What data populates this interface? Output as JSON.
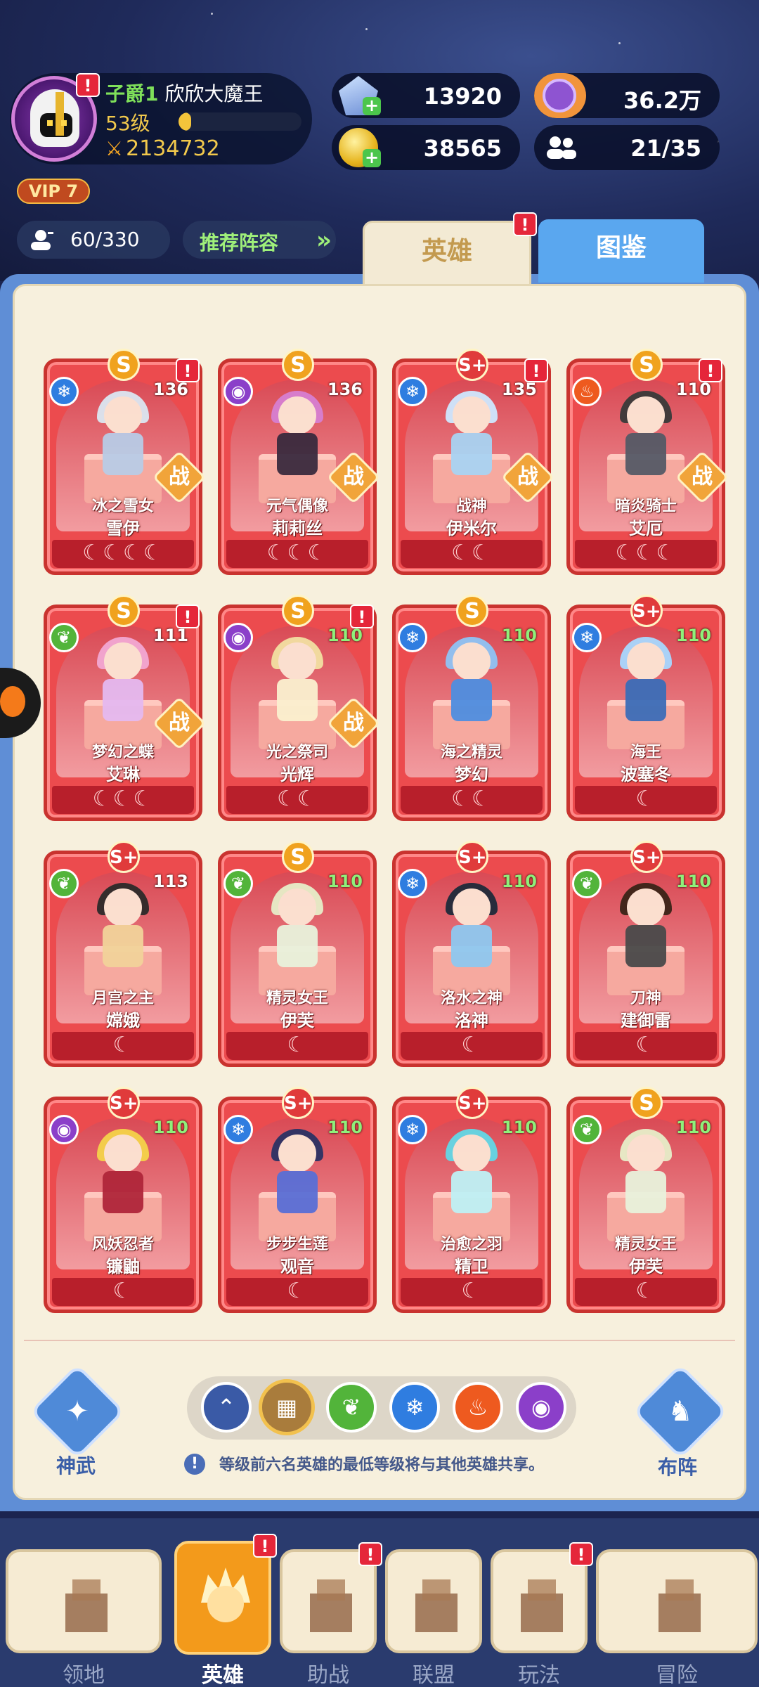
{
  "player": {
    "rank": "子爵1",
    "name": "欣欣大魔王",
    "level": "53级",
    "level_progress": 0.1,
    "power": "2134732",
    "vip": "VIP 7"
  },
  "currencies": {
    "diamonds": "13920",
    "energy": "36.2万",
    "energy_fill_pct": 28,
    "gold": "38565",
    "members": "21/35"
  },
  "hero_count": "60/330",
  "recommend_label": "推荐阵容",
  "tabs": [
    {
      "label": "英雄",
      "active": true,
      "alert": "!"
    },
    {
      "label": "图鉴",
      "active": false
    }
  ],
  "heroes": [
    {
      "grade": "S",
      "element": "ice",
      "level": "136",
      "title": "冰之雪女",
      "name": "雪伊",
      "moons": "☾☾☾☾",
      "battle": "战",
      "alert": "!",
      "hair": "#dbe7f2",
      "outfit": "#b8cbe6"
    },
    {
      "grade": "S",
      "element": "dark",
      "level": "136",
      "title": "元气偶像",
      "name": "莉莉丝",
      "moons": "☾☾☾",
      "battle": "战",
      "alert": "",
      "hair": "#d77fd1",
      "outfit": "#3a2a3e"
    },
    {
      "grade": "S+",
      "element": "ice",
      "level": "135",
      "title": "战神",
      "name": "伊米尔",
      "moons": "☾☾",
      "battle": "战",
      "alert": "!",
      "hair": "#cfe8ff",
      "outfit": "#a9d3f2"
    },
    {
      "grade": "S",
      "element": "fire",
      "level": "110",
      "title": "暗炎骑士",
      "name": "艾厄",
      "moons": "☾☾☾",
      "battle": "战",
      "alert": "!",
      "hair": "#3a3a3a",
      "outfit": "#555a66"
    },
    {
      "grade": "S",
      "element": "nature",
      "level": "111",
      "title": "梦幻之蝶",
      "name": "艾琳",
      "moons": "☾☾☾",
      "battle": "战",
      "alert": "!",
      "hair": "#f3a8d3",
      "outfit": "#e5b9f0"
    },
    {
      "grade": "S",
      "element": "dark",
      "level": "110",
      "title": "光之祭司",
      "name": "光辉",
      "moons": "☾☾",
      "battle": "战",
      "alert": "!",
      "hair": "#f3e0a2",
      "outfit": "#fbf0cf"
    },
    {
      "grade": "S",
      "element": "ice",
      "level": "110",
      "title": "海之精灵",
      "name": "梦幻",
      "moons": "☾☾",
      "battle": "",
      "alert": "",
      "hair": "#8fc4f5",
      "outfit": "#4f8ee0"
    },
    {
      "grade": "S+",
      "element": "ice",
      "level": "110",
      "title": "海王",
      "name": "波塞冬",
      "moons": "☾",
      "battle": "",
      "alert": "",
      "hair": "#a8d8ff",
      "outfit": "#3c6db8"
    },
    {
      "grade": "S+",
      "element": "nature",
      "level": "113",
      "title": "月宫之主",
      "name": "嫦娥",
      "moons": "☾",
      "battle": "",
      "alert": "",
      "hair": "#2d2a2a",
      "outfit": "#f2d39a"
    },
    {
      "grade": "S",
      "element": "nature",
      "level": "110",
      "title": "精灵女王",
      "name": "伊芙",
      "moons": "☾",
      "battle": "",
      "alert": "",
      "hair": "#e7eec9",
      "outfit": "#e9f2dc"
    },
    {
      "grade": "S+",
      "element": "ice",
      "level": "110",
      "title": "洛水之神",
      "name": "洛神",
      "moons": "☾",
      "battle": "",
      "alert": "",
      "hair": "#1f2a3a",
      "outfit": "#8fc8f0"
    },
    {
      "grade": "S+",
      "element": "nature",
      "level": "110",
      "title": "刀神",
      "name": "建御雷",
      "moons": "☾",
      "battle": "",
      "alert": "",
      "hair": "#3b2418",
      "outfit": "#4a4a4a"
    },
    {
      "grade": "S+",
      "element": "dark",
      "level": "110",
      "title": "风妖忍者",
      "name": "镰鼬",
      "moons": "☾",
      "battle": "",
      "alert": "",
      "hair": "#f5d34a",
      "outfit": "#b0263a"
    },
    {
      "grade": "S+",
      "element": "ice",
      "level": "110",
      "title": "步步生莲",
      "name": "观音",
      "moons": "☾",
      "battle": "",
      "alert": "",
      "hair": "#2b3264",
      "outfit": "#5a6fd6"
    },
    {
      "grade": "S+",
      "element": "ice",
      "level": "110",
      "title": "治愈之羽",
      "name": "精卫",
      "moons": "☾",
      "battle": "",
      "alert": "",
      "hair": "#62d8e6",
      "outfit": "#bff1f5"
    },
    {
      "grade": "S",
      "element": "nature",
      "level": "110",
      "title": "精灵女王",
      "name": "伊芙",
      "moons": "☾",
      "battle": "",
      "alert": "",
      "hair": "#e7eec9",
      "outfit": "#e9f2dc"
    }
  ],
  "controls": {
    "shenwu_label": "神武",
    "formation_label": "布阵",
    "filters": [
      "up",
      "all",
      "nature",
      "ice",
      "fire",
      "dark"
    ],
    "selected_filter": "all",
    "note": "等级前六名英雄的最低等级将与其他英雄共享。"
  },
  "nav": [
    {
      "label": "领地",
      "active": false,
      "alert": ""
    },
    {
      "label": "英雄",
      "active": true,
      "alert": "!"
    },
    {
      "label": "助战",
      "active": false,
      "alert": "!"
    },
    {
      "label": "联盟",
      "active": false,
      "alert": ""
    },
    {
      "label": "玩法",
      "active": false,
      "alert": "!"
    },
    {
      "label": "冒险",
      "active": false,
      "alert": ""
    }
  ],
  "colors": {
    "accent": "#ec4b4e",
    "panel": "#f7f0dd",
    "frame": "#5f8ed6",
    "nav_active": "#f39a1b"
  }
}
